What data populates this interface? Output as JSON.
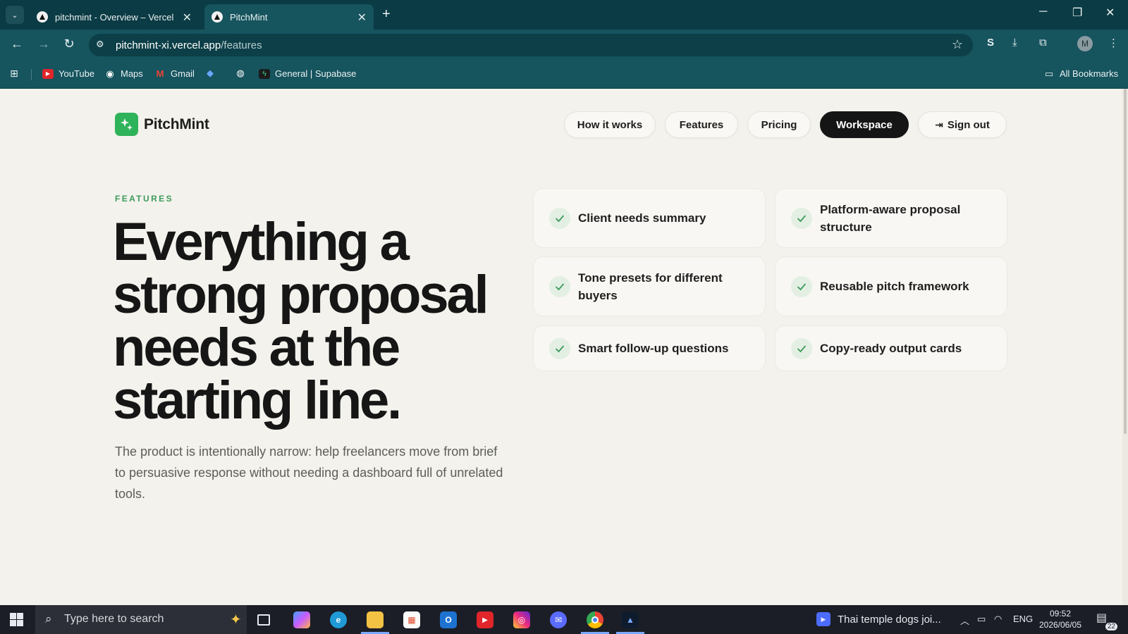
{
  "browser": {
    "tabs": [
      {
        "title": "pitchmint - Overview – Vercel",
        "active": false
      },
      {
        "title": "PitchMint",
        "active": true
      }
    ],
    "url_host": "pitchmint-xi.vercel.app",
    "url_path": "/features",
    "profile_initial": "M",
    "bookmarks": [
      {
        "label": "YouTube",
        "icon": "youtube-icon"
      },
      {
        "label": "Maps",
        "icon": "maps-icon"
      },
      {
        "label": "Gmail",
        "icon": "gmail-icon"
      },
      {
        "label": "",
        "icon": "gem-icon"
      },
      {
        "label": "",
        "icon": "globe-icon"
      },
      {
        "label": "General | Supabase",
        "icon": "supabase-icon"
      }
    ],
    "all_bookmarks_label": "All Bookmarks"
  },
  "site": {
    "brand": "PitchMint",
    "nav": [
      {
        "label": "How it works",
        "variant": "light"
      },
      {
        "label": "Features",
        "variant": "light"
      },
      {
        "label": "Pricing",
        "variant": "light"
      },
      {
        "label": "Workspace",
        "variant": "dark"
      },
      {
        "label": "Sign out",
        "variant": "light",
        "icon": "sign-out-icon"
      }
    ],
    "eyebrow": "FEATURES",
    "hero_lines": [
      "Everything a",
      "strong proposal",
      "needs at the",
      "starting line."
    ],
    "lede": "The product is intentionally narrow: help freelancers move from brief to persuasive response without needing a dashboard full of unrelated tools.",
    "features": [
      "Client needs summary",
      "Platform-aware proposal structure",
      "Tone presets for different buyers",
      "Reusable pitch framework",
      "Smart follow-up questions",
      "Copy-ready output cards"
    ],
    "colors": {
      "accent": "#3e9b5c",
      "logo": "#2fb35a",
      "dark_pill": "#151515"
    }
  },
  "taskbar": {
    "search_placeholder": "Type here to search",
    "media_title": "Thai temple dogs joi...",
    "language": "ENG",
    "time": "09:52",
    "date": "2026/06/05",
    "notification_count": "22"
  }
}
